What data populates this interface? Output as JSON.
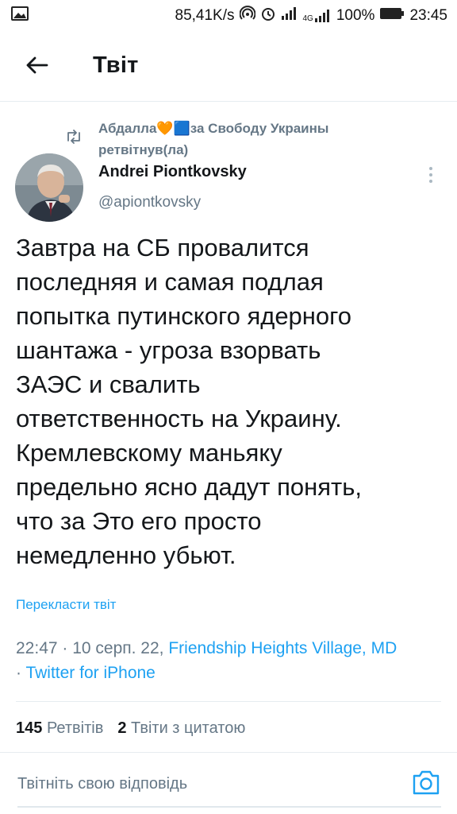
{
  "status_bar": {
    "net_speed": "85,41K/s",
    "network_type": "4G",
    "battery": "100%",
    "time": "23:45"
  },
  "header": {
    "title": "Твіт"
  },
  "tweet": {
    "retweeted_by": "Абдалла🧡🟦за Свободу Украины ретвітнув(ла)",
    "author_name": "Andrei Piontkovsky",
    "author_handle": "@apiontkovsky",
    "text": "Завтра на СБ провалится\nпоследняя и самая подлая\nпопытка путинского ядерного\nшантажа - угроза взорвать\nЗАЭС  и свалить\nответственность на Украину.\nКремлевскому маньяку\nпредельно ясно дадут понять,\nчто за Это его просто\nнемедленно убьют.",
    "translate_label": "Перекласти твіт",
    "timestamp": "22:47 · 10 серп. 22, ",
    "location": "Friendship Heights Village, MD",
    "separator": "· ",
    "source": "Twitter for iPhone"
  },
  "stats": {
    "retweets_count": "145",
    "retweets_label": "Ретвітів",
    "quotes_count": "2",
    "quotes_label": "Твіти з цитатою"
  },
  "reply": {
    "placeholder": "Твітніть свою відповідь"
  },
  "colors": {
    "accent": "#1da1f2",
    "secondary_text": "#657786",
    "primary_text": "#14171a",
    "divider": "#e6ecf0"
  },
  "icons": {
    "status_left": "image-icon",
    "back": "arrow-left-icon",
    "retweet": "retweet-icon",
    "more": "more-vertical-icon",
    "camera": "camera-icon"
  }
}
